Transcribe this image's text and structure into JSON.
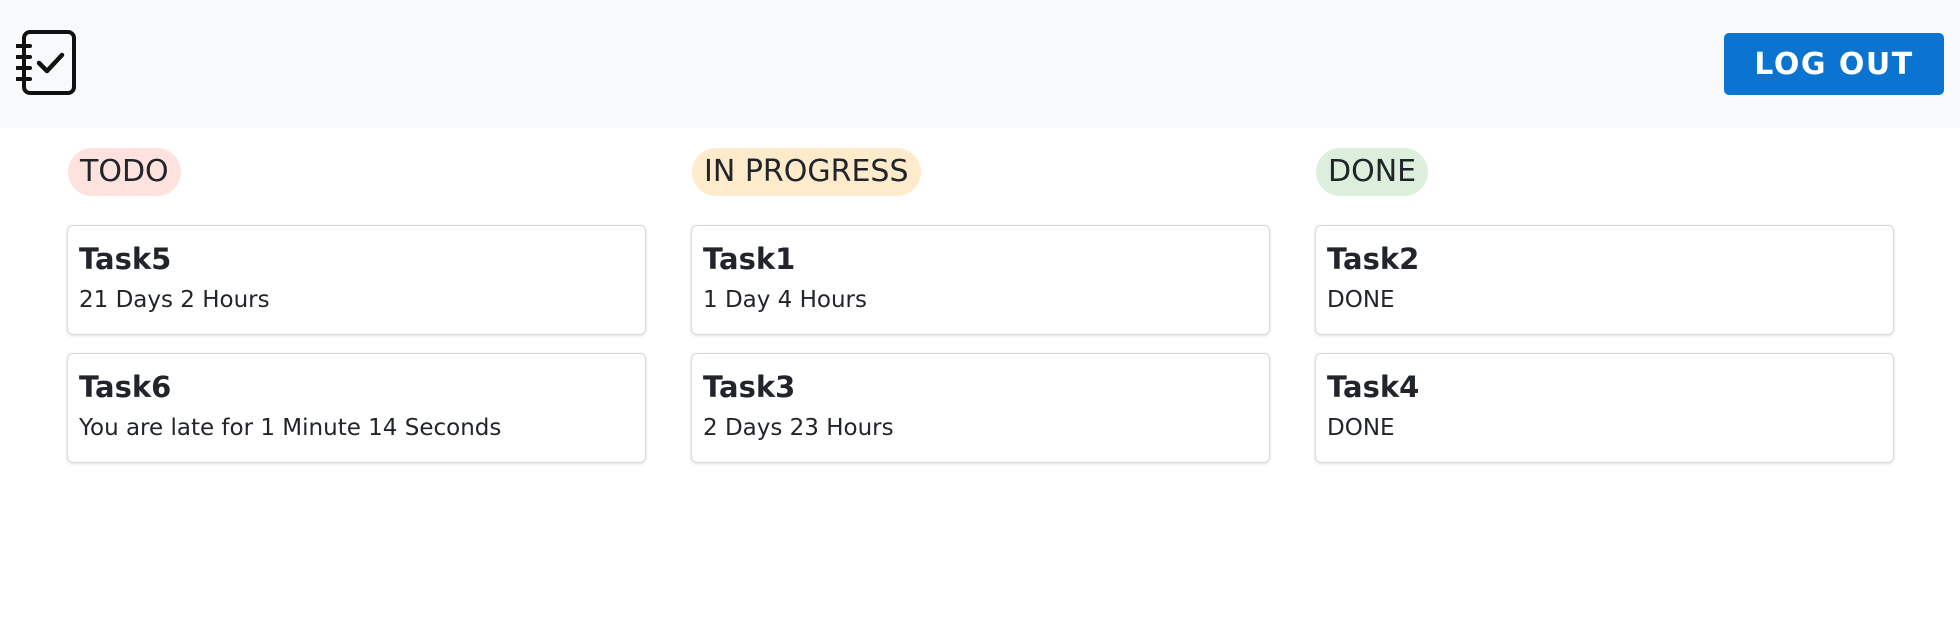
{
  "header": {
    "logo_icon": "task-list-check-icon",
    "logout_label": "LOG OUT",
    "accent_color": "#0a74d0"
  },
  "columns": [
    {
      "label": "TODO",
      "badge_color": "#fde2de",
      "cards": [
        {
          "title": "Task5",
          "subtitle": "21 Days 2 Hours"
        },
        {
          "title": "Task6",
          "subtitle": "You are late for 1 Minute 14 Seconds"
        }
      ]
    },
    {
      "label": "IN PROGRESS",
      "badge_color": "#fdebcc",
      "cards": [
        {
          "title": "Task1",
          "subtitle": "1 Day 4 Hours"
        },
        {
          "title": "Task3",
          "subtitle": "2 Days 23 Hours"
        }
      ]
    },
    {
      "label": "DONE",
      "badge_color": "#dcefdc",
      "cards": [
        {
          "title": "Task2",
          "subtitle": "DONE"
        },
        {
          "title": "Task4",
          "subtitle": "DONE"
        }
      ]
    }
  ]
}
